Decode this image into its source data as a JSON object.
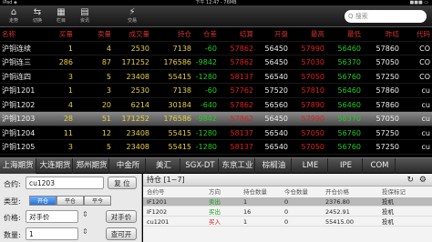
{
  "status_bar": {
    "left": "iPad ◈",
    "center": "下午 12:47 - 76MB",
    "right": "■■■ ▭"
  },
  "toolbar": {
    "buttons": [
      {
        "icon": "⌂",
        "label": "走势",
        "name": "home-icon"
      },
      {
        "icon": "⇆",
        "label": "切换",
        "name": "switch-icon"
      },
      {
        "icon": "▦",
        "label": "栏目",
        "name": "menu-grid-icon"
      },
      {
        "icon": "▤",
        "label": "资讯",
        "name": "news-icon"
      },
      {
        "icon": "⚡",
        "label": "交易",
        "name": "trade-icon"
      }
    ],
    "search_placeholder": "Q 搜索"
  },
  "quote_table": {
    "columns": [
      "名称",
      "买量",
      "卖量",
      "成交量",
      "持仓",
      "仓差",
      "结算",
      "开盘",
      "最高",
      "最低",
      "昨结",
      "代码"
    ],
    "rows": [
      {
        "cells": [
          "沪铜连续",
          "1",
          "4",
          "2530",
          "7138",
          "-60",
          "57862",
          "56450",
          "57990",
          "56460",
          "57860",
          "CO"
        ],
        "colors": [
          "wht",
          "yel",
          "yel",
          "yel",
          "yel",
          "grn",
          "red",
          "wht",
          "red",
          "grn",
          "wht",
          "wht"
        ]
      },
      {
        "cells": [
          "沪铜连三",
          "286",
          "87",
          "171252",
          "176586",
          "-9842",
          "57862",
          "56450",
          "57030",
          "56370",
          "57050",
          "CO"
        ],
        "colors": [
          "wht",
          "yel",
          "yel",
          "yel",
          "yel",
          "grn",
          "red",
          "wht",
          "red",
          "grn",
          "wht",
          "wht"
        ]
      },
      {
        "cells": [
          "沪铜连四",
          "3",
          "5",
          "23408",
          "55415",
          "-1280",
          "58137",
          "56540",
          "57050",
          "56760",
          "57250",
          "CO"
        ],
        "colors": [
          "wht",
          "yel",
          "yel",
          "yel",
          "yel",
          "grn",
          "red",
          "wht",
          "red",
          "grn",
          "wht",
          "wht"
        ]
      },
      {
        "cells": [
          "沪铜1201",
          "1",
          "3",
          "2530",
          "7138",
          "-60",
          "57762",
          "57520",
          "57810",
          "56460",
          "57860",
          "cu"
        ],
        "colors": [
          "wht",
          "yel",
          "yel",
          "yel",
          "yel",
          "grn",
          "red",
          "wht",
          "red",
          "grn",
          "wht",
          "wht"
        ]
      },
      {
        "cells": [
          "沪铜1202",
          "4",
          "20",
          "6214",
          "30184",
          "-640",
          "57862",
          "56560",
          "57890",
          "56460",
          "57860",
          "cu"
        ],
        "colors": [
          "wht",
          "yel",
          "yel",
          "yel",
          "yel",
          "grn",
          "red",
          "wht",
          "red",
          "grn",
          "wht",
          "wht"
        ]
      },
      {
        "cells": [
          "沪铜1203",
          "28",
          "51",
          "171252",
          "176586",
          "-9842",
          "57862",
          "56450",
          "57990",
          "56370",
          "57050",
          "cu"
        ],
        "colors": [
          "wht",
          "yel",
          "yel",
          "yel",
          "yel",
          "grn",
          "red",
          "wht",
          "red",
          "grn",
          "wht",
          "wht"
        ],
        "selected": true
      },
      {
        "cells": [
          "沪铜1204",
          "11",
          "12",
          "23408",
          "55415",
          "-1280",
          "58137",
          "56540",
          "57050",
          "56760",
          "57250",
          "cu"
        ],
        "colors": [
          "wht",
          "yel",
          "yel",
          "yel",
          "yel",
          "grn",
          "red",
          "wht",
          "red",
          "grn",
          "wht",
          "wht"
        ]
      },
      {
        "cells": [
          "沪铜1205",
          "3",
          "5",
          "23408",
          "55415",
          "-1280",
          "58137",
          "56540",
          "57050",
          "56760",
          "57250",
          "cu"
        ],
        "colors": [
          "wht",
          "yel",
          "yel",
          "yel",
          "yel",
          "grn",
          "red",
          "wht",
          "red",
          "grn",
          "wht",
          "wht"
        ]
      }
    ]
  },
  "exchange_tabs": [
    "上海期货",
    "大连期货",
    "郑州期货",
    "中金所",
    "美汇",
    "SGX-DT",
    "东京工业",
    "棕榈油",
    "LME",
    "IPE",
    "COM"
  ],
  "order_panel": {
    "contract_label": "合约:",
    "contract_value": "cu1203",
    "reset_button": "复 位",
    "type_label": "类型:",
    "type_options": [
      "开仓",
      "平仓",
      "平今"
    ],
    "price_label": "价格:",
    "price_value": "对手价",
    "opponent_button": "对手价",
    "qty_label": "数量:",
    "qty_value": "1",
    "available_button": "查可开"
  },
  "position_panel": {
    "title": "持仓 [1~7]",
    "columns": [
      "合约号",
      "方向",
      "持仓数量",
      "今仓数量",
      "开仓价格",
      "投保标记"
    ],
    "rows": [
      {
        "cells": [
          "IF1201",
          "卖出",
          "1",
          "0",
          "2376.80",
          "投机"
        ],
        "dir_color": "#1a9a1a",
        "selected": true
      },
      {
        "cells": [
          "IF1202",
          "买出",
          "16",
          "0",
          "2452.91",
          "投机"
        ],
        "dir_color": "#1a9a1a"
      },
      {
        "cells": [
          "cu1201",
          "买入",
          "1",
          "0",
          "55415.00",
          "投机"
        ],
        "dir_color": "#d02020"
      }
    ]
  }
}
